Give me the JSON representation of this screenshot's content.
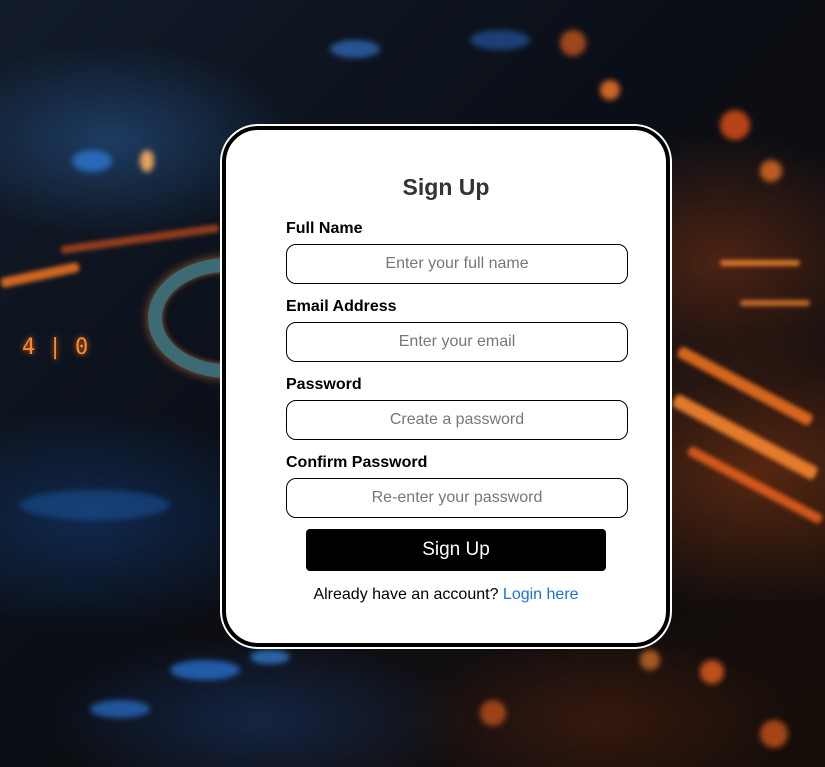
{
  "form": {
    "title": "Sign Up",
    "fields": [
      {
        "label": "Full Name",
        "placeholder": "Enter your full name",
        "value": ""
      },
      {
        "label": "Email Address",
        "placeholder": "Enter your email",
        "value": ""
      },
      {
        "label": "Password",
        "placeholder": "Create a password",
        "value": ""
      },
      {
        "label": "Confirm Password",
        "placeholder": "Re-enter your password",
        "value": ""
      }
    ],
    "submit_label": "Sign Up",
    "footer_text": "Already have an account?",
    "login_link": "Login here"
  },
  "background": {
    "digits": "4 | 0"
  },
  "colors": {
    "card_background": "#ffffff",
    "card_border": "#000000",
    "button_background": "#000000",
    "button_text": "#ffffff",
    "link": "#1a73d9",
    "title": "#333333"
  }
}
